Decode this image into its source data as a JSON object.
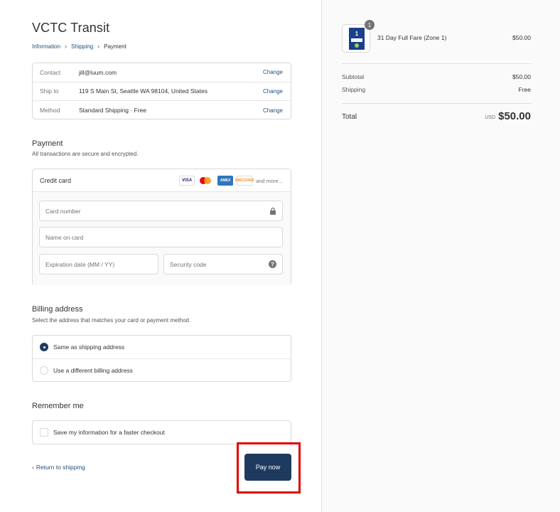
{
  "store": {
    "title": "VCTC Transit"
  },
  "breadcrumb": {
    "information": "Information",
    "shipping": "Shipping",
    "payment": "Payment"
  },
  "review": {
    "contact": {
      "label": "Contact",
      "value": "jill@luum.com",
      "action": "Change"
    },
    "ship_to": {
      "label": "Ship to",
      "value": "119 S Main St, Seattle WA 98104, United States",
      "action": "Change"
    },
    "method": {
      "label": "Method",
      "value": "Standard Shipping · Free",
      "action": "Change"
    }
  },
  "payment": {
    "title": "Payment",
    "subtitle": "All transactions are secure and encrypted.",
    "credit_card_label": "Credit card",
    "logos": {
      "visa": "VISA",
      "amex": "AMEX",
      "discover": "DISCOVER",
      "more": "and more..."
    },
    "card_number_placeholder": "Card number",
    "name_placeholder": "Name on card",
    "expiry_placeholder": "Expiration date (MM / YY)",
    "security_placeholder": "Security code"
  },
  "billing": {
    "title": "Billing address",
    "subtitle": "Select the address that matches your card or payment method.",
    "options": [
      "Same as shipping address",
      "Use a different billing address"
    ],
    "selected": "Same as shipping address"
  },
  "remember": {
    "title": "Remember me",
    "checkbox_label": "Save my information for a faster checkout"
  },
  "footer": {
    "return_label": "Return to shipping",
    "pay_label": "Pay now"
  },
  "summary": {
    "item": {
      "name": "31 Day Full Fare (Zone 1)",
      "price": "$50.00",
      "quantity": "1",
      "ticket_number": "1"
    },
    "subtotal_label": "Subtotal",
    "subtotal_value": "$50.00",
    "shipping_label": "Shipping",
    "shipping_value": "Free",
    "total_label": "Total",
    "currency": "USD",
    "total_value": "$50.00"
  },
  "colors": {
    "accent": "#1f3a5f",
    "link": "#1f4f7a",
    "highlight": "#e00000"
  }
}
